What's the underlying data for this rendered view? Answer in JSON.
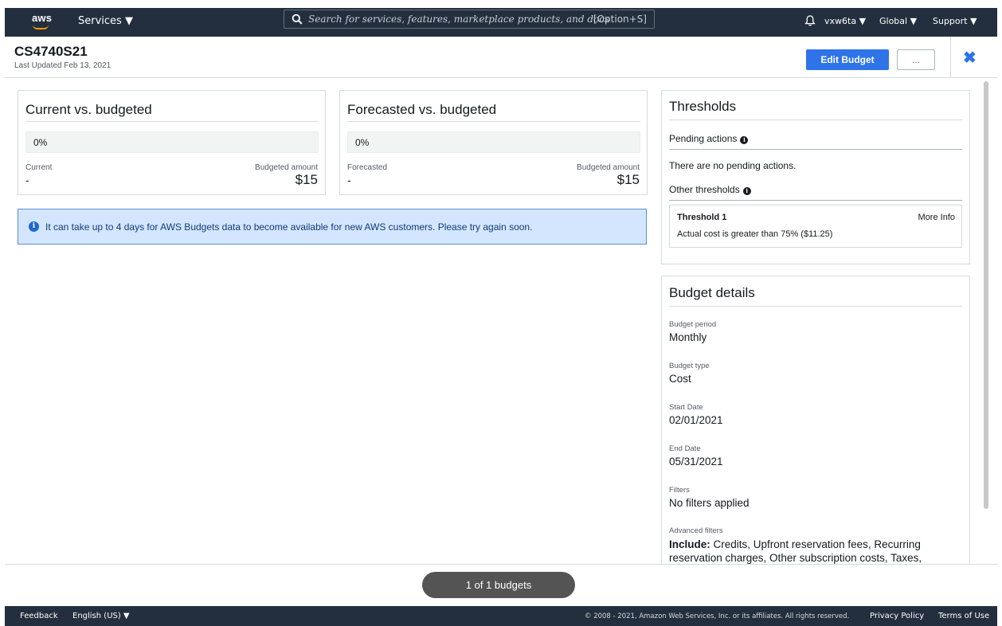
{
  "nav": {
    "logo": "aws",
    "services": "Services ▼",
    "search_placeholder": "Search for services, features, marketplace products, and docs",
    "search_shortcut": "[Option+S]",
    "account": "vxw6ta ▼",
    "region": "Global ▼",
    "support": "Support ▼",
    "brand_color": "#ff9900",
    "bar_color": "#232f3e"
  },
  "header": {
    "title": "CS4740S21",
    "subtitle": "Last Updated Feb 13, 2021",
    "edit_button": "Edit Budget",
    "more_button": "...",
    "close": "✖"
  },
  "current_card": {
    "title": "Current vs. budgeted",
    "progress": "0%",
    "left_label": "Current",
    "left_value": "-",
    "right_label": "Budgeted amount",
    "right_value": "$15"
  },
  "forecast_card": {
    "title": "Forecasted vs. budgeted",
    "progress": "0%",
    "left_label": "Forecasted",
    "left_value": "-",
    "right_label": "Budgeted amount",
    "right_value": "$15"
  },
  "info_banner": {
    "message": "It can take up to 4 days for AWS Budgets data to become available for new AWS customers. Please try again soon."
  },
  "thresholds": {
    "title": "Thresholds",
    "pending_label": "Pending actions",
    "pending_text": "There are no pending actions.",
    "other_label": "Other thresholds",
    "items": [
      {
        "name": "Threshold 1",
        "link": "More Info",
        "description": "Actual cost is greater than 75% ($11.25)"
      }
    ]
  },
  "details": {
    "title": "Budget details",
    "fields": [
      {
        "label": "Budget period",
        "value": "Monthly"
      },
      {
        "label": "Budget type",
        "value": "Cost"
      },
      {
        "label": "Start Date",
        "value": "02/01/2021"
      },
      {
        "label": "End Date",
        "value": "05/31/2021"
      },
      {
        "label": "Filters",
        "value": "No filters applied"
      }
    ],
    "advanced_label": "Advanced filters",
    "advanced_bold": "Include:",
    "advanced_line1": "Credits, Upfront reservation fees, Recurring",
    "advanced_line2": "reservation charges, Other subscription costs, Taxes,"
  },
  "pagination": "1 of 1 budgets",
  "footer": {
    "feedback": "Feedback",
    "language": "English (US) ▼",
    "copyright": "© 2008 - 2021, Amazon Web Services, Inc. or its affiliates. All rights reserved.",
    "privacy": "Privacy Policy",
    "terms": "Terms of Use"
  }
}
